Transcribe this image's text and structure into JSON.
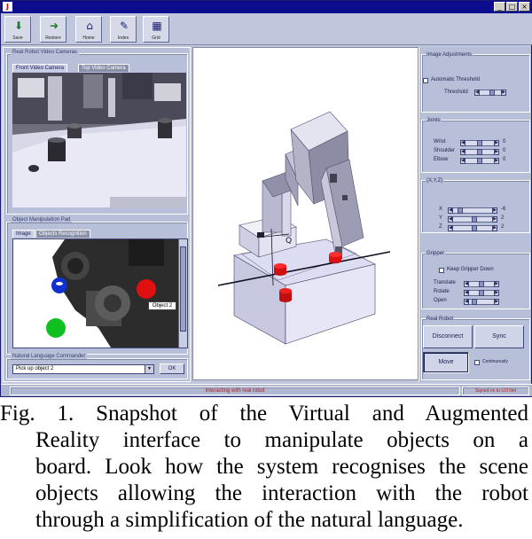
{
  "window": {
    "java_icon_label": "J",
    "buttons": [
      "_",
      "□",
      "×"
    ]
  },
  "toolbar": {
    "buttons": [
      {
        "label": "Save",
        "icon": "arrow-down-icon"
      },
      {
        "label": "Restore",
        "icon": "arrow-right-icon"
      },
      {
        "label": "Home",
        "icon": "home-icon"
      },
      {
        "label": "Index",
        "icon": "index-icon"
      },
      {
        "label": "Grid",
        "icon": "grid-icon"
      }
    ]
  },
  "left": {
    "cameras_title": "Real Robot Video Cameras",
    "camera_tabs": [
      "Front Video Camera",
      "Top Video Camera"
    ],
    "manipulation_title": "Object Manipulation Pad",
    "manip_tabs": [
      "Image",
      "Objects Recognition"
    ],
    "object_label": "Object 2",
    "nl_title": "Natural Language Commander",
    "nl_value": "Pick up object 2",
    "ok_label": "OK"
  },
  "right": {
    "image_adjust_title": "Image Adjustments",
    "auto_threshold_label": "Automatic Threshold",
    "threshold_label": "Threshold",
    "joints_title": "Joints",
    "joints": [
      {
        "label": "Wrist",
        "value": "0"
      },
      {
        "label": "Shoulder",
        "value": "0"
      },
      {
        "label": "Elbow",
        "value": "0"
      }
    ],
    "xyz_title": "(X,Y,Z)",
    "xyz": [
      {
        "label": "X",
        "value": "-6"
      },
      {
        "label": "Y",
        "value": "2"
      },
      {
        "label": "Z",
        "value": "2"
      }
    ],
    "gripper_title": "Gripper",
    "keep_gripper_label": "Keep Gripper Down",
    "gripper_controls": [
      "Translate",
      "Rotate",
      "Open"
    ],
    "real_robot_title": "Real Robot",
    "disconnect_label": "Disconnect",
    "sync_label": "Sync",
    "move_label": "Move",
    "continuously_label": "Continuously"
  },
  "status": {
    "main": "Interacting with real robot",
    "right": "Signed on to UJI Net"
  },
  "caption": {
    "lines": [
      "Fig.  1.  Snapshot  of  the  Virtual  and  Augmented",
      "Reality  interface  to  manipulate  objects  on  a",
      "board.  Look  how  the  system  recognises  the  scene",
      "objects  allowing  the  interaction  with  the  robot",
      "through a simplification of the natural language."
    ]
  },
  "colors": {
    "titlebar": "#0c0c8e",
    "panel": "#b8bfd8",
    "status_text": "#b01818",
    "object_red": "#e01010",
    "object_blue": "#1030d0",
    "object_green": "#10c020"
  }
}
